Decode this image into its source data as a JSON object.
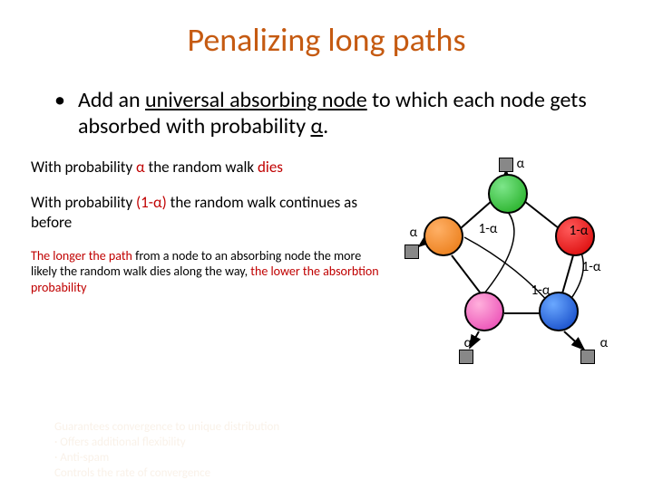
{
  "title": "Penalizing long paths",
  "bullet": {
    "prefix": "Add an ",
    "uni": "universal absorbing node",
    "mid": " to which each node gets absorbed with probability ",
    "alpha": "α",
    "end": "."
  },
  "p1": {
    "a": "With probability ",
    "b": "α",
    "c": " the random walk ",
    "d": "dies"
  },
  "p2": {
    "a": "With probability ",
    "b": "(1-α)",
    "c": " the random walk continues as before"
  },
  "p3": {
    "a": "The longer the path",
    "b": " from a node to an absorbing node the more likely the random walk dies along the way, ",
    "c": "the lower the absorbtion probability"
  },
  "labels": {
    "alpha": "α",
    "one_minus": "1-α"
  },
  "ghost_text": "Guarantees convergence to unique distribution\n· Offers additional flexibility\n· Anti-spam\nControls the rate of convergence"
}
